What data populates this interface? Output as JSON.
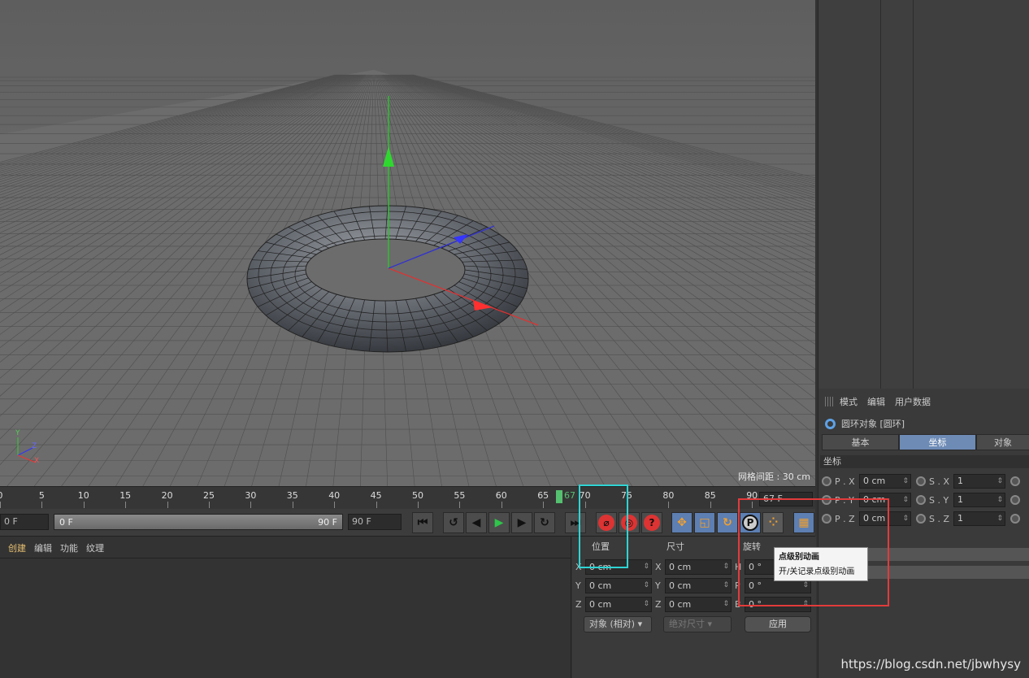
{
  "viewport": {
    "grid_spacing": "网格间距 : 30 cm",
    "axis_labels": {
      "y": "Y",
      "z": "Z",
      "x": "X"
    }
  },
  "timeline": {
    "ticks": [
      "0",
      "5",
      "10",
      "15",
      "20",
      "25",
      "30",
      "35",
      "40",
      "45",
      "50",
      "55",
      "60",
      "65",
      "70",
      "75",
      "80",
      "85",
      "90"
    ],
    "current_frame_marker": "67",
    "current_frame_field": "67 F"
  },
  "controls": {
    "start_field": "0 F",
    "range_start": "0 F",
    "range_end": "90 F",
    "end_field": "90 F"
  },
  "material_menu": [
    "创建",
    "编辑",
    "功能",
    "纹理"
  ],
  "coords_manager": {
    "headers": {
      "position": "位置",
      "size": "尺寸",
      "rotation": "旋转"
    },
    "rows": [
      {
        "axis": "X",
        "pos": "0 cm",
        "size_axis": "X",
        "size": "0 cm",
        "rot_axis": "H",
        "rot": "0 °"
      },
      {
        "axis": "Y",
        "pos": "0 cm",
        "size_axis": "Y",
        "size": "0 cm",
        "rot_axis": "P",
        "rot": "0 °"
      },
      {
        "axis": "Z",
        "pos": "0 cm",
        "size_axis": "Z",
        "size": "0 cm",
        "rot_axis": "B",
        "rot": "0 °"
      }
    ],
    "mode_dropdown": "对象 (相对)",
    "size_dropdown": "绝对尺寸",
    "apply_button": "应用"
  },
  "tooltip": {
    "title": "点级别动画",
    "description": "开/关记录点级别动画"
  },
  "attribute_manager": {
    "menu": [
      "模式",
      "编辑",
      "用户数据"
    ],
    "object_title": "圆环对象 [圆环]",
    "tabs": [
      "基本",
      "坐标",
      "对象"
    ],
    "active_tab": "坐标",
    "section": "坐标",
    "rows": [
      {
        "p_label": "P . X",
        "p_val": "0 cm",
        "s_label": "S . X",
        "s_val": "1"
      },
      {
        "p_label": "P . Y",
        "p_val": "0 cm",
        "s_label": "S . Y",
        "s_val": "1"
      },
      {
        "p_label": "P . Z",
        "p_val": "0 cm",
        "s_label": "S . Z",
        "s_val": "1"
      }
    ]
  },
  "watermark": "https://blog.csdn.net/jbwhysy",
  "colors": {
    "accent_blue": "#6d8bb5",
    "highlight_cyan": "#2fd4d4",
    "highlight_red": "#e23b3b",
    "playhead_green": "#55c070"
  }
}
